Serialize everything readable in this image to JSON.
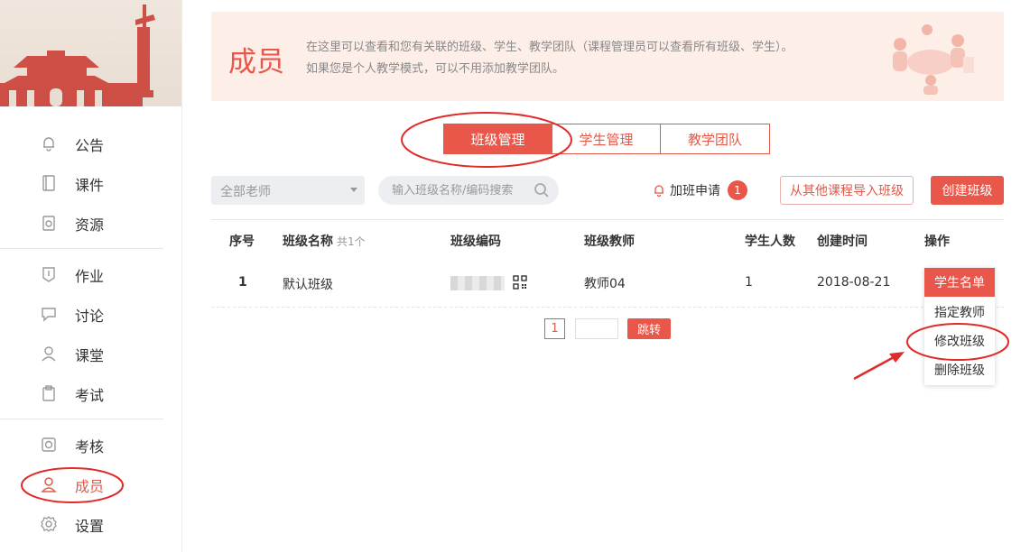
{
  "colors": {
    "accent": "#e8574a",
    "header_bg": "#fdeee8",
    "annotation": "#e02b2b"
  },
  "sidebar": {
    "items": [
      {
        "label": "公告",
        "icon": "bell-icon"
      },
      {
        "label": "课件",
        "icon": "book-icon"
      },
      {
        "label": "资源",
        "icon": "resource-icon"
      },
      {
        "label": "作业",
        "icon": "homework-icon"
      },
      {
        "label": "讨论",
        "icon": "chat-icon"
      },
      {
        "label": "课堂",
        "icon": "classroom-icon"
      },
      {
        "label": "考试",
        "icon": "exam-icon"
      },
      {
        "label": "考核",
        "icon": "assessment-icon"
      },
      {
        "label": "成员",
        "icon": "member-icon"
      },
      {
        "label": "设置",
        "icon": "gear-icon"
      }
    ],
    "active": "成员"
  },
  "header": {
    "title": "成员",
    "desc_line1": "在这里可以查看和您有关联的班级、学生、教学团队（课程管理员可以查看所有班级、学生）。",
    "desc_line2": "如果您是个人教学模式，可以不用添加教学团队。"
  },
  "tabs": [
    {
      "label": "班级管理",
      "active": true
    },
    {
      "label": "学生管理",
      "active": false
    },
    {
      "label": "教学团队",
      "active": false
    }
  ],
  "toolbar": {
    "teacher_select": "全部老师",
    "search_placeholder": "输入班级名称/编码搜索",
    "apply_label": "加班申请",
    "apply_count": "1",
    "import_label": "从其他课程导入班级",
    "create_label": "创建班级"
  },
  "table": {
    "headers": {
      "index": "序号",
      "name": "班级名称",
      "name_count": "共1个",
      "code": "班级编码",
      "teacher": "班级教师",
      "students": "学生人数",
      "created": "创建时间",
      "ops": "操作"
    },
    "rows": [
      {
        "index": "1",
        "name": "默认班级",
        "teacher": "教师04",
        "students": "1",
        "created": "2018-08-21"
      }
    ]
  },
  "pagination": {
    "current": "1",
    "go_label": "跳转"
  },
  "op_menu": [
    "学生名单",
    "指定教师",
    "修改班级",
    "删除班级"
  ]
}
